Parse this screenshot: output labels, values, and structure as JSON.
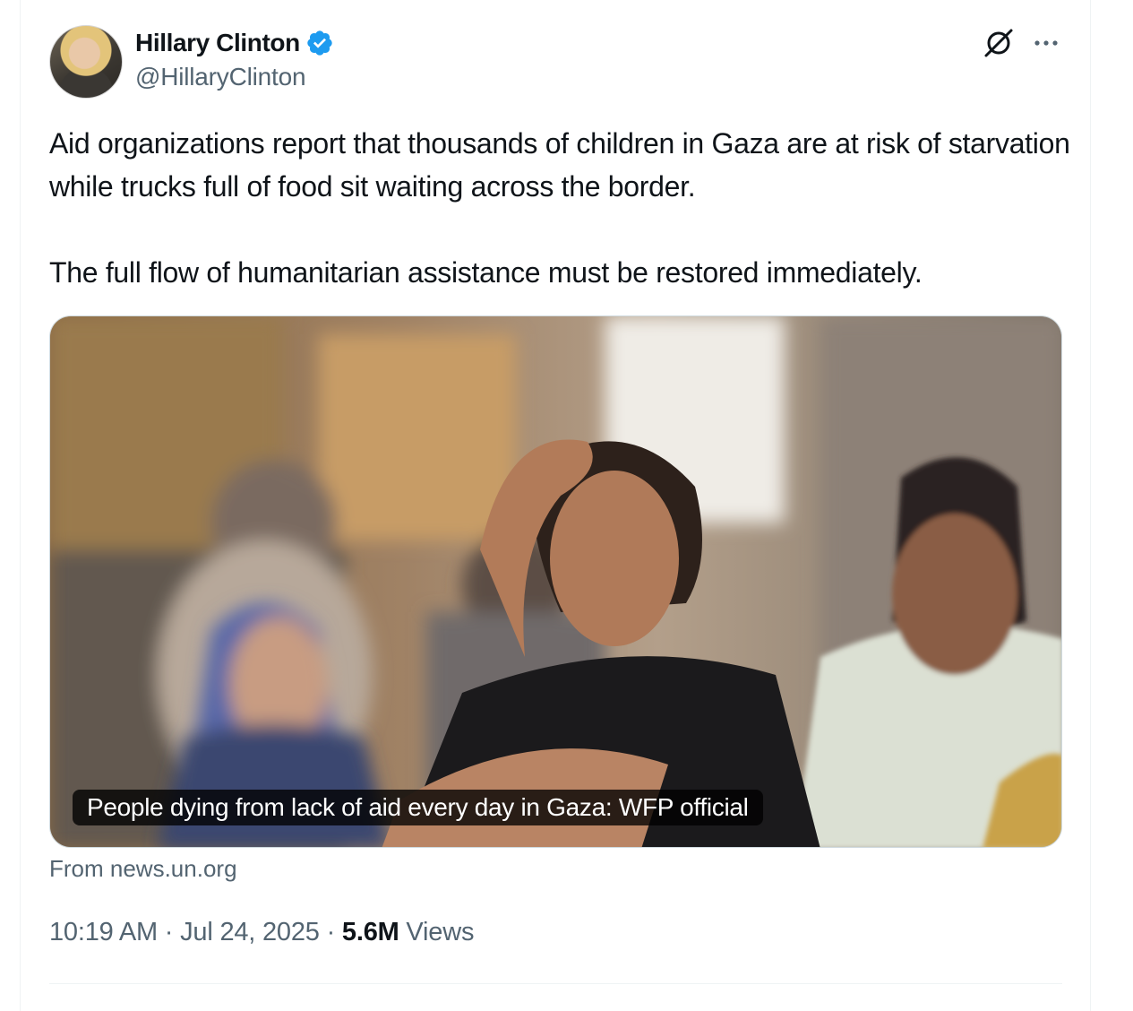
{
  "author": {
    "name": "Hillary Clinton",
    "handle": "@HillaryClinton",
    "verified": true,
    "verified_color": "#1d9bf0",
    "avatar_icon": "profile-photo"
  },
  "actions": {
    "grok_icon": "slashed-circle-icon",
    "more_icon": "ellipsis-icon"
  },
  "tweet": {
    "paragraph1": "Aid organizations report that thousands of children in Gaza are at risk of starvation while trucks full of food sit waiting across the border.",
    "paragraph2": "The full flow of humanitarian assistance must be restored immediately."
  },
  "card": {
    "caption": "People dying from lack of aid every day in Gaza: WFP official",
    "source": "From news.un.org"
  },
  "meta": {
    "time": "10:19 AM",
    "sep1": " · ",
    "date": "Jul 24, 2025",
    "sep2": " · ",
    "views_count": "5.6M",
    "views_label": " Views"
  }
}
